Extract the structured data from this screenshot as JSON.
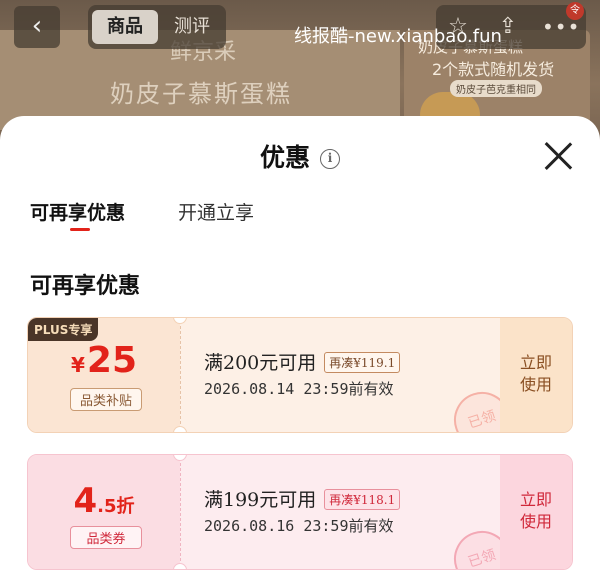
{
  "watermark": "线报酷-new.xianbao.fun",
  "background": {
    "brand": "鲜京采",
    "product_title": "奶皮子慕斯蛋糕",
    "side_line1": "奶皮子慕斯蛋糕",
    "side_line2": "2个款式随机发货",
    "side_tag": "奶皮子芭克重相同"
  },
  "nav": {
    "tabs": [
      "商品",
      "测评"
    ],
    "badge": "令"
  },
  "sheet": {
    "title": "优惠",
    "tabs": [
      "可再享优惠",
      "开通立享"
    ],
    "section_title": "可再享优惠"
  },
  "coupons": [
    {
      "plus_tag": "PLUS专享",
      "currency": "¥",
      "amount": "25",
      "category": "品类补贴",
      "condition": "满200元可用",
      "extra": "再凑¥119.1",
      "expire": "2026.08.14 23:59前有效",
      "action": "立即使用",
      "stamp": "已领"
    },
    {
      "amount_main": "4",
      "amount_rest": ".5折",
      "category": "品类券",
      "condition": "满199元可用",
      "extra": "再凑¥118.1",
      "expire": "2026.08.16 23:59前有效",
      "action": "立即使用",
      "stamp": "已领"
    }
  ],
  "colors": {
    "accent": "#e2231a",
    "plus_dark": "#4a3528"
  },
  "icons": [
    "back-arrow-icon",
    "star-icon",
    "share-icon",
    "more-icon",
    "info-icon",
    "close-icon"
  ]
}
